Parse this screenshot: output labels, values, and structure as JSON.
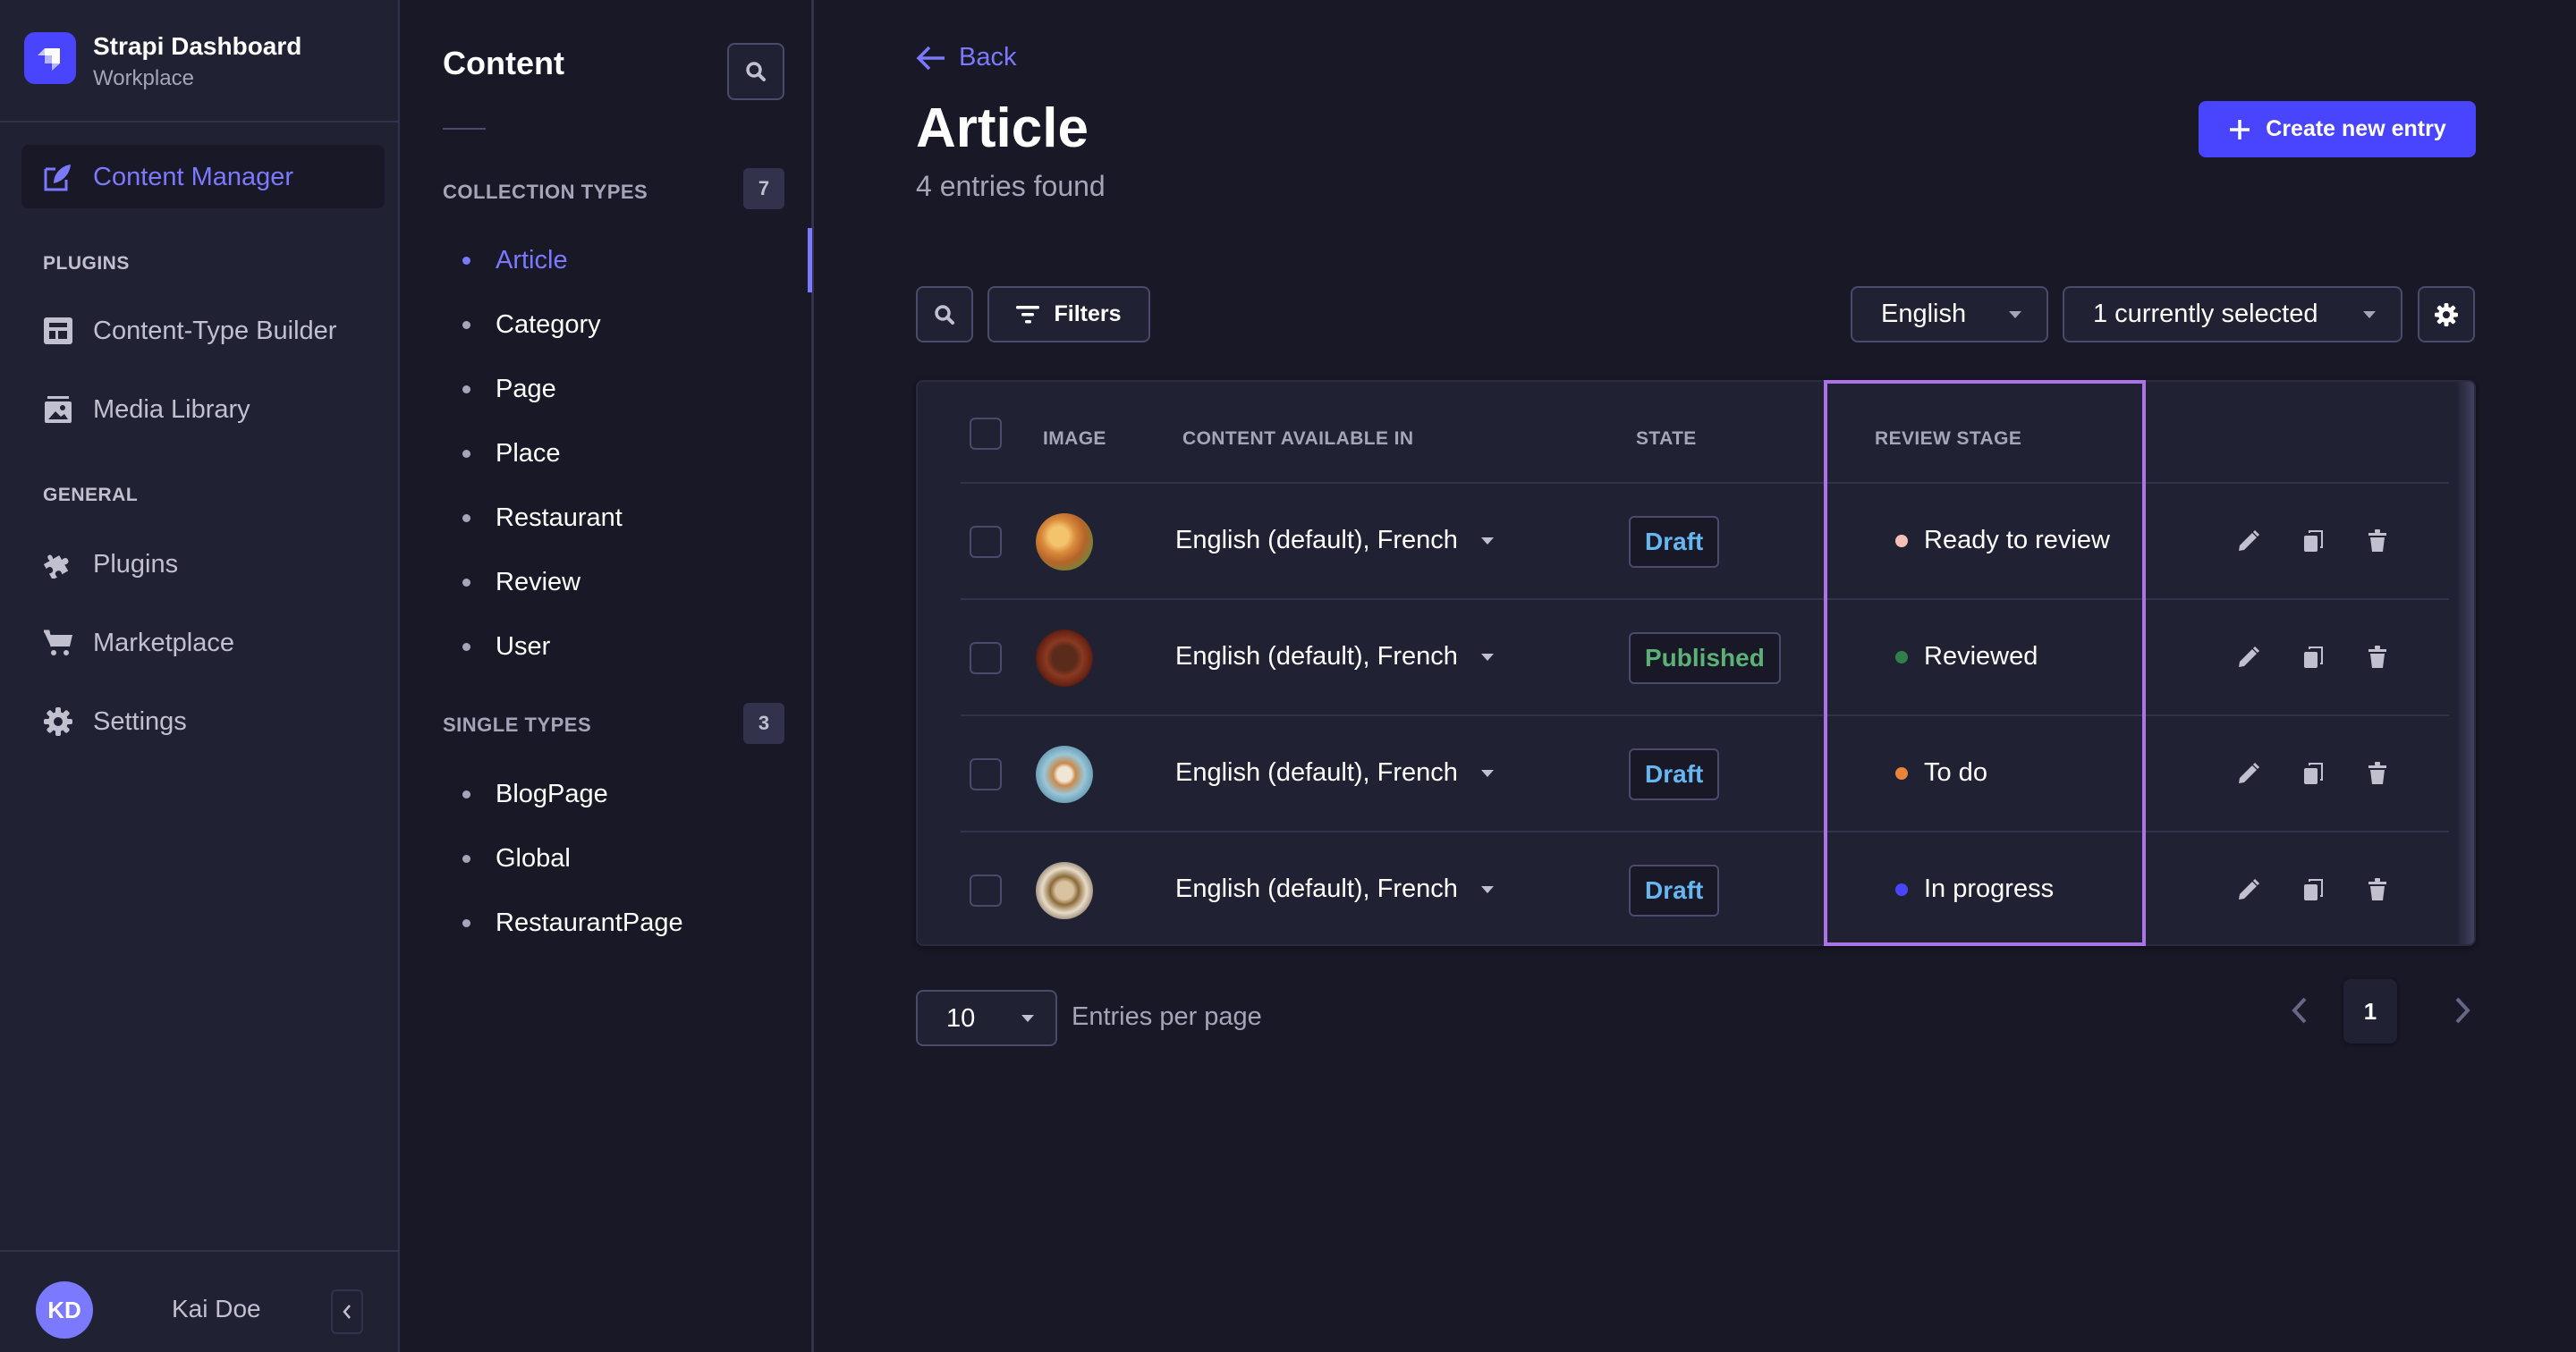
{
  "brand": {
    "title": "Strapi Dashboard",
    "subtitle": "Workplace",
    "color": "#4945ff"
  },
  "mainnav": {
    "active": {
      "label": "Content Manager",
      "icon": "feather-icon"
    },
    "sections": [
      {
        "title": "PLUGINS",
        "items": [
          {
            "label": "Content-Type Builder",
            "icon": "layout-icon"
          },
          {
            "label": "Media Library",
            "icon": "images-icon"
          }
        ]
      },
      {
        "title": "GENERAL",
        "items": [
          {
            "label": "Plugins",
            "icon": "puzzle-icon"
          },
          {
            "label": "Marketplace",
            "icon": "cart-icon"
          },
          {
            "label": "Settings",
            "icon": "gear-icon"
          }
        ]
      }
    ],
    "user": {
      "initials": "KD",
      "name": "Kai Doe"
    }
  },
  "subnav": {
    "title": "Content",
    "collection_types": {
      "title": "COLLECTION TYPES",
      "count": "7",
      "items": [
        "Article",
        "Category",
        "Page",
        "Place",
        "Restaurant",
        "Review",
        "User"
      ],
      "active": "Article"
    },
    "single_types": {
      "title": "SINGLE TYPES",
      "count": "3",
      "items": [
        "BlogPage",
        "Global",
        "RestaurantPage"
      ]
    }
  },
  "header": {
    "back_label": "Back",
    "title": "Article",
    "subtitle": "4 entries found",
    "create_label": "Create new entry"
  },
  "toolbar": {
    "filters_label": "Filters",
    "locale_value": "English",
    "columns_value": "1 currently selected"
  },
  "table": {
    "headers": {
      "image": "IMAGE",
      "locales": "CONTENT AVAILABLE IN",
      "state": "STATE",
      "review_stage": "REVIEW STAGE"
    },
    "rows": [
      {
        "locales": "English (default), French",
        "state": "Draft",
        "state_color": "#66b7f1",
        "stage": "Ready to review",
        "stage_color": "#f5c0b8"
      },
      {
        "locales": "English (default), French",
        "state": "Published",
        "state_color": "#5cb176",
        "stage": "Reviewed",
        "stage_color": "#328048"
      },
      {
        "locales": "English (default), French",
        "state": "Draft",
        "state_color": "#66b7f1",
        "stage": "To do",
        "stage_color": "#e8853a"
      },
      {
        "locales": "English (default), French",
        "state": "Draft",
        "state_color": "#66b7f1",
        "stage": "In progress",
        "stage_color": "#4945ff"
      }
    ],
    "highlight_color": "#ac73e6"
  },
  "pagination": {
    "per_page_value": "10",
    "per_page_label": "Entries per page",
    "current_page": "1"
  }
}
